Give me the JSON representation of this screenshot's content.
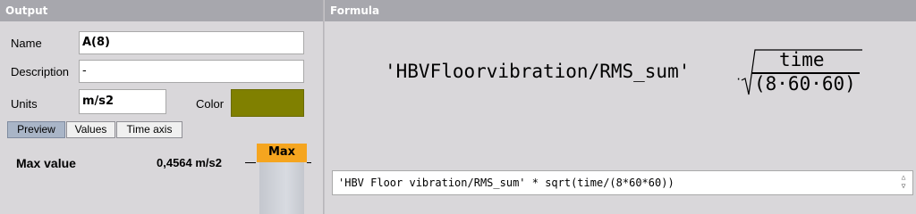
{
  "headers": {
    "output": "Output",
    "formula": "Formula"
  },
  "form": {
    "name_label": "Name",
    "name_value": "A(8)",
    "description_label": "Description",
    "description_value": "-",
    "units_label": "Units",
    "units_value": "m/s2",
    "color_label": "Color",
    "color_value": "#808000"
  },
  "tabs": [
    {
      "label": "Preview",
      "active": true
    },
    {
      "label": "Values",
      "active": false
    },
    {
      "label": "Time axis",
      "active": false
    }
  ],
  "preview": {
    "max_label": "Max value",
    "max_value": "0,4564 m/s2",
    "gauge_label": "Max"
  },
  "formula": {
    "rendered_prefix": "'HBVFloorvibration/RMS_sum'",
    "rendered_dot": "·",
    "numerator": "time",
    "denominator": "(8·60·60)",
    "text": "'HBV Floor vibration/RMS_sum' * sqrt(time/(8*60*60))"
  }
}
